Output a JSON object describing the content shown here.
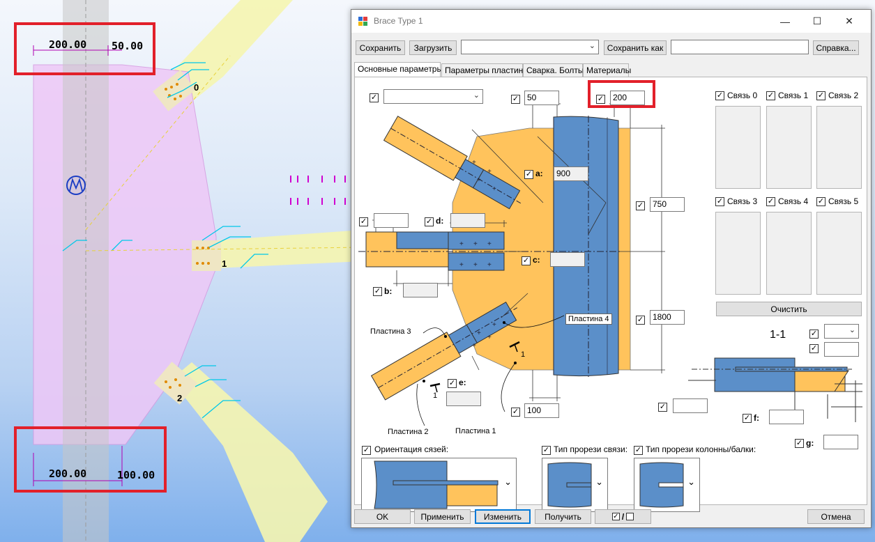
{
  "cad": {
    "dim_top_left": "200.00",
    "dim_top_right": "50.00",
    "dim_bottom_left": "200.00",
    "dim_bottom_right": "100.00",
    "node_labels": [
      "0",
      "1",
      "2"
    ]
  },
  "window": {
    "title": "Brace Type 1",
    "minimize_icon": "minimize-icon",
    "maximize_icon": "maximize-icon",
    "close_icon": "close-icon"
  },
  "toolbar": {
    "save": "Сохранить",
    "load": "Загрузить",
    "preset_value": "",
    "save_as": "Сохранить как",
    "save_as_value": "",
    "help": "Справка..."
  },
  "tabs": [
    "Основные параметры",
    "Параметры пластин",
    "Сварка. Болты",
    "Материалы"
  ],
  "params": {
    "top_combo": "",
    "top_dim": "50",
    "top_dim2": "200",
    "a_label": "a:",
    "a_value": "900",
    "b_label": "b:",
    "b_value": "",
    "c_label": "c:",
    "c_value": "",
    "d_label": "d:",
    "d_value": "",
    "e_label": "e:",
    "e_value": "",
    "left_value": "",
    "h1": "750",
    "h2": "1800",
    "bottom_dim": "100",
    "plate2": "Пластина 2",
    "plate1": "Пластина 1",
    "plate3": "Пластина 3",
    "plate4": "Пластина 4",
    "section_mark": "1",
    "section_mark2": "1",
    "section_title": "1-1",
    "sec_combo": "",
    "sec_val": "",
    "sec_left_val": "",
    "f_label": "f:",
    "f_value": "",
    "g_label": "g:",
    "g_value": ""
  },
  "links": [
    "Связь 0",
    "Связь 1",
    "Связь 2",
    "Связь 3",
    "Связь 4",
    "Связь 5"
  ],
  "clear_button": "Очистить",
  "orient": {
    "orientation_label": "Ориентация сязей:",
    "slot_brace_label": "Тип прорези связи:",
    "slot_column_label": "Тип прорези колонны/балки:"
  },
  "footer": {
    "ok": "OK",
    "apply": "Применить",
    "change": "Изменить",
    "get": "Получить",
    "toggle": "/",
    "cancel": "Отмена"
  },
  "colors": {
    "plate": "#ffc35c",
    "steel": "#5b8fc9",
    "highlight": "#e2202a",
    "gusset": "#eec8f7"
  }
}
